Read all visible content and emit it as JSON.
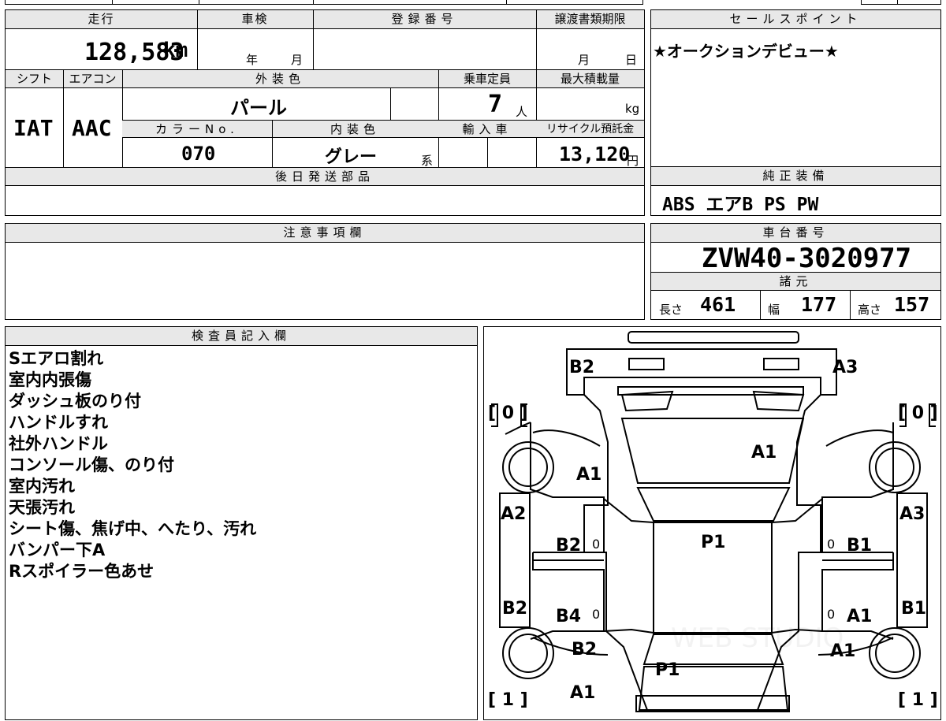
{
  "top_strip": [
    "",
    "",
    "",
    "",
    ""
  ],
  "main": {
    "mileage_header": "走行",
    "mileage_value": "128,583",
    "mileage_unit": "km",
    "shaken_header": "車検",
    "shaken_year": "年",
    "shaken_month": "月",
    "registration_header": "登録番号",
    "registration_value": "",
    "transfer_header": "譲渡書類期限",
    "transfer_month": "月",
    "transfer_day": "日",
    "shift_header": "シフト",
    "shift_value": "IAT",
    "ac_header": "エアコン",
    "ac_value": "AAC",
    "exterior_color_header": "外装色",
    "exterior_color_value": "パール",
    "capacity_header": "乗車定員",
    "capacity_value": "7",
    "capacity_unit": "人",
    "max_load_header": "最大積載量",
    "max_load_unit": "kg",
    "color_no_header": "カラーNo.",
    "color_no_value": "070",
    "interior_color_header": "内装色",
    "interior_color_value": "グレー",
    "interior_suffix": "系",
    "import_header": "輸入車",
    "recycle_header": "リサイクル預託金",
    "recycle_value": "13,120",
    "recycle_unit": "円",
    "later_parts_header": "後日発送部品",
    "later_parts_value": ""
  },
  "sales_point": {
    "header": "セールスポイント",
    "text": "★オークションデビュー★"
  },
  "equipment": {
    "header": "純正装備",
    "items": "ABS エアB PS PW"
  },
  "caution": {
    "header": "注意事項欄",
    "text": ""
  },
  "chassis": {
    "header": "車台番号",
    "value": "ZVW40-3020977",
    "spec_header": "諸元",
    "length_label": "長さ",
    "length_value": "461",
    "width_label": "幅",
    "width_value": "177",
    "height_label": "高さ",
    "height_value": "157"
  },
  "inspector": {
    "header": "検査員記入欄",
    "lines": [
      "Sエアロ割れ",
      "室内内張傷",
      "ダッシュ板のり付",
      "ハンドルすれ",
      "社外ハンドル",
      "コンソール傷、のり付",
      "室内汚れ",
      "天張汚れ",
      "シート傷、焦げ中、へたり、汚れ",
      "バンパー下A",
      "Rスポイラー色あせ"
    ]
  },
  "diagram": {
    "tire_fl": "[ 0 ]",
    "tire_fr": "[ 0 ]",
    "tire_rl": "[ 1 ]",
    "tire_rr": "[ 1 ]",
    "marks": {
      "front_bumper_left": "B2",
      "front_bumper_right": "A3",
      "hood": "A1",
      "left_fender": "A1",
      "left_front_edge": "A2",
      "left_front_door": "B2",
      "left_front_door_zero": "0",
      "left_rear_edge": "B2",
      "left_rear_door": "B4",
      "left_rear_door_zero": "0",
      "left_rear_fender": "B2",
      "left_rear_bottom": "A1",
      "roof": "P1",
      "trunk": "P1",
      "right_front_edge": "A3",
      "right_front_door": "B1",
      "right_front_door_zero": "0",
      "right_rear_edge": "B1",
      "right_rear_door": "A1",
      "right_rear_door_zero": "0",
      "right_rear_fender": "A1"
    },
    "watermark": "WEB STUDIO"
  }
}
